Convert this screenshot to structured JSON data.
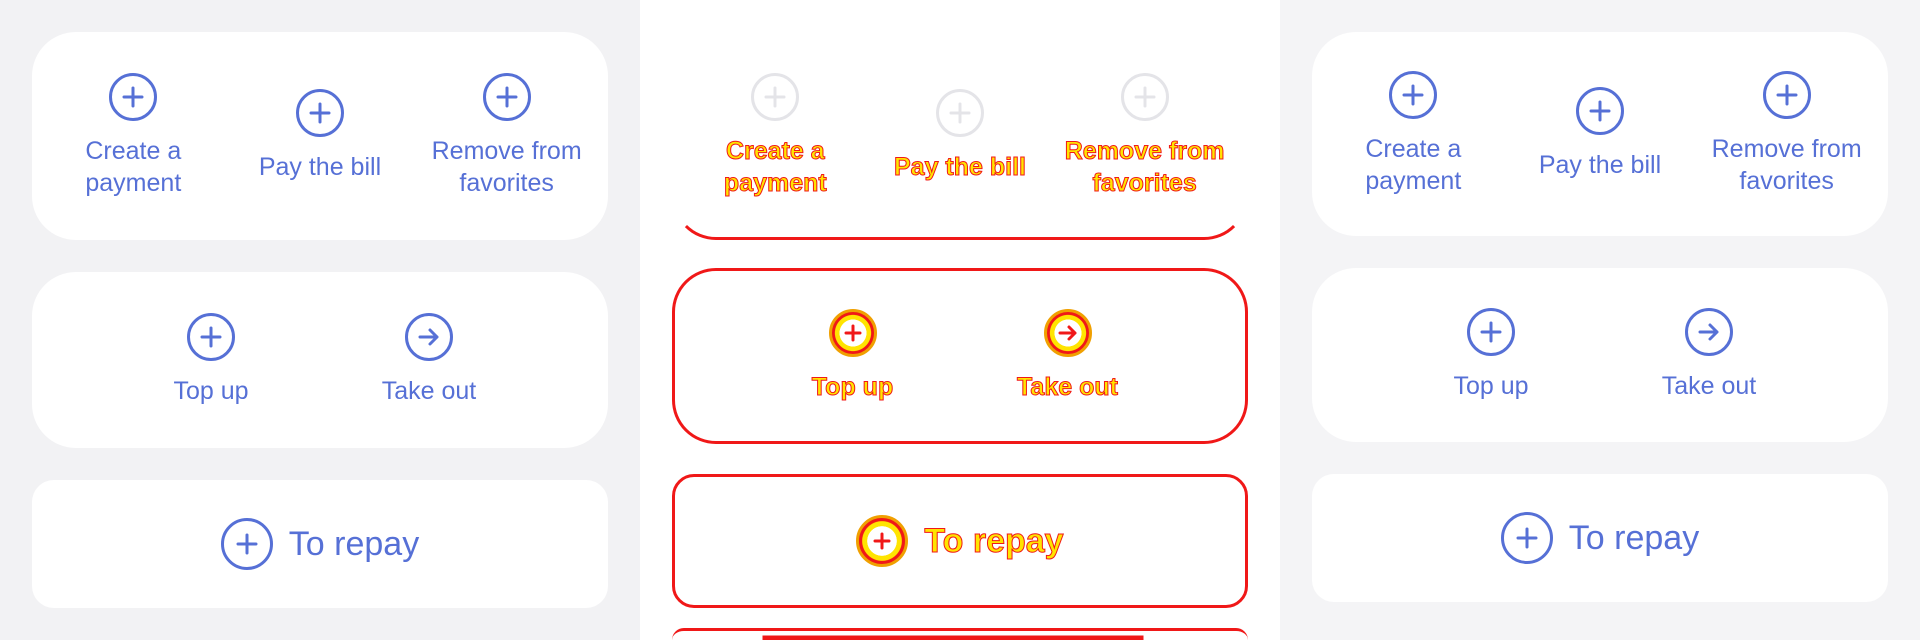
{
  "colors": {
    "accent": "#5670D6",
    "diff_red": "#F01818",
    "diff_yellow": "#FFE400"
  },
  "panels": [
    {
      "name": "reference",
      "quick_actions": [
        {
          "label": "Create a\npayment",
          "icon": "plus-circle-icon"
        },
        {
          "label": "Pay the bill",
          "icon": "plus-circle-icon"
        },
        {
          "label": "Remove from\nfavorites",
          "icon": "plus-circle-icon"
        }
      ],
      "balance_actions": [
        {
          "label": "Top up",
          "icon": "plus-circle-icon"
        },
        {
          "label": "Take out",
          "icon": "arrow-right-circle-icon"
        }
      ],
      "repay": {
        "label": "To repay",
        "icon": "plus-circle-icon"
      }
    },
    {
      "name": "diff",
      "quick_actions": [
        {
          "label": "Create a\npayment",
          "icon": "plus-circle-icon"
        },
        {
          "label": "Pay the bill",
          "icon": "plus-circle-icon"
        },
        {
          "label": "Remove from\nfavorites",
          "icon": "plus-circle-icon"
        }
      ],
      "balance_actions": [
        {
          "label": "Top up",
          "icon": "plus-circle-icon"
        },
        {
          "label": "Take out",
          "icon": "arrow-right-circle-icon"
        }
      ],
      "repay": {
        "label": "To repay",
        "icon": "plus-circle-icon"
      }
    },
    {
      "name": "actual",
      "quick_actions": [
        {
          "label": "Create a\npayment",
          "icon": "plus-circle-icon"
        },
        {
          "label": "Pay the bill",
          "icon": "plus-circle-icon"
        },
        {
          "label": "Remove from\nfavorites",
          "icon": "plus-circle-icon"
        }
      ],
      "balance_actions": [
        {
          "label": "Top up",
          "icon": "plus-circle-icon"
        },
        {
          "label": "Take out",
          "icon": "arrow-right-circle-icon"
        }
      ],
      "repay": {
        "label": "To repay",
        "icon": "plus-circle-icon"
      }
    }
  ]
}
